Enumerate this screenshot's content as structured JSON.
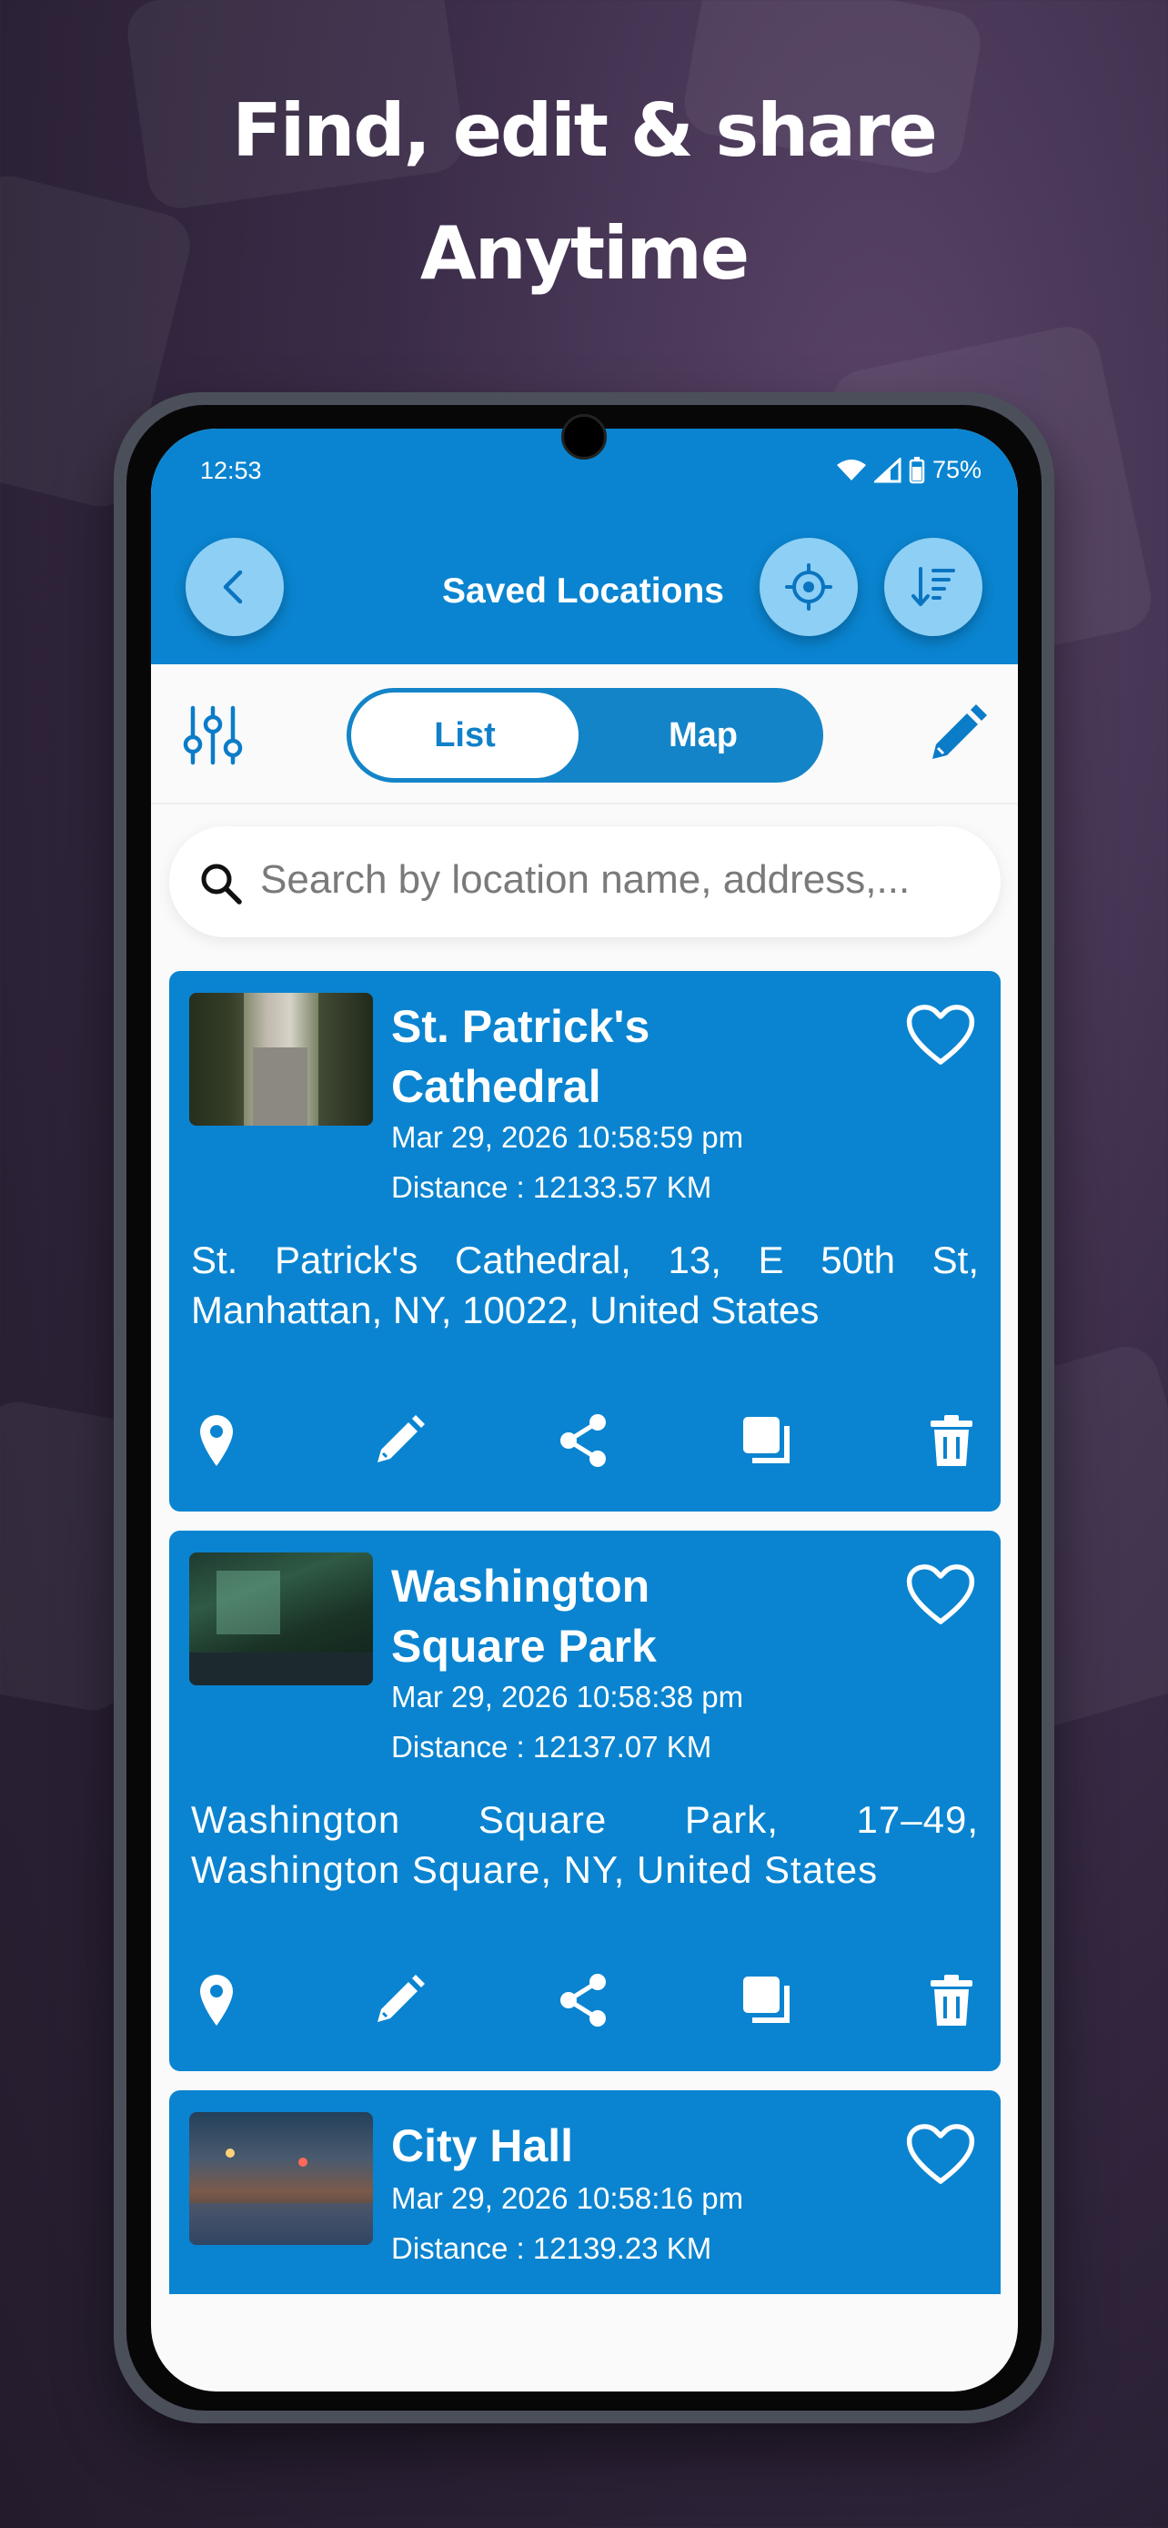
{
  "headline": {
    "line1": "Find, edit & share",
    "line2": "Anytime"
  },
  "status_bar": {
    "time": "12:53",
    "battery": "75%"
  },
  "app_bar": {
    "title": "Saved Locations",
    "icons": [
      "back-icon",
      "locate-icon",
      "sort-icon"
    ]
  },
  "toolbar": {
    "tabs": [
      {
        "label": "List",
        "active": true
      },
      {
        "label": "Map",
        "active": false
      }
    ],
    "icons": [
      "filter-icon",
      "edit-icon"
    ]
  },
  "search": {
    "placeholder": "Search by location name, address,..."
  },
  "locations": [
    {
      "name_line1": "St. Patrick's",
      "name_line2": "Cathedral",
      "datetime": "Mar 29, 2026 10:58:59 pm",
      "distance": "Distance : 12133.57 KM",
      "address": "St. Patrick's Cathedral, 13, E 50th St, Manhattan, NY, 10022, United States"
    },
    {
      "name_line1": "Washington",
      "name_line2": "Square Park",
      "datetime": "Mar 29, 2026 10:58:38 pm",
      "distance": "Distance : 12137.07 KM",
      "address": "Washington Square Park, 17–49, Washington Square, NY, United States"
    },
    {
      "name_line1": "City Hall",
      "name_line2": "",
      "datetime": "Mar 29, 2026 10:58:16 pm",
      "distance": "Distance : 12139.23 KM",
      "address": ""
    }
  ],
  "card_actions": [
    "map-pin-icon",
    "edit-icon",
    "share-icon",
    "copy-icon",
    "delete-icon"
  ],
  "colors": {
    "primary": "#0a84d0",
    "accent_light": "#8dcff5",
    "background": "#fafafa"
  }
}
